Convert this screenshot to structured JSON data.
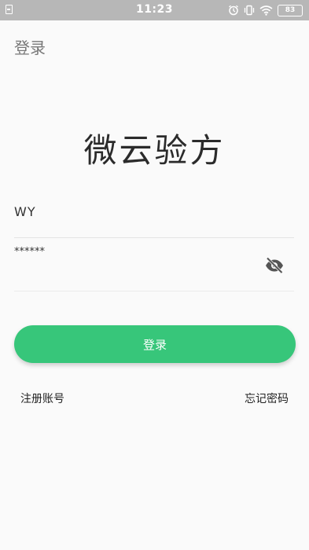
{
  "status_bar": {
    "time": "11:23",
    "battery": "83"
  },
  "header": {
    "title": "登录"
  },
  "app": {
    "title": "微云验方"
  },
  "login_form": {
    "username_value": "WY",
    "password_value": "******",
    "password_toggle_icon": "eye-off-icon",
    "login_label": "登录",
    "button_color": "#37c67a"
  },
  "links": {
    "register": "注册账号",
    "forgot_password": "忘记密码"
  }
}
